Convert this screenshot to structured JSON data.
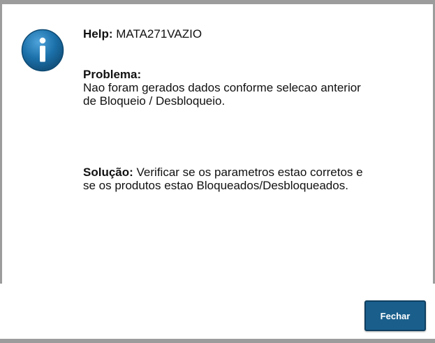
{
  "help": {
    "label": "Help:",
    "code": "MATA271VAZIO"
  },
  "problem": {
    "heading": "Problema:",
    "text_line1": "Nao foram gerados dados conforme selecao anterior",
    "text_line2": "de Bloqueio / Desbloqueio."
  },
  "solution": {
    "label": "Solução:",
    "text_line1": " Verificar se os parametros estao corretos e",
    "text_line2": "se os produtos estao Bloqueados/Desbloqueados."
  },
  "buttons": {
    "close_label": "Fechar"
  },
  "icon": {
    "name": "info-icon",
    "color": "#1b6fa8"
  },
  "colors": {
    "button_bg": "#1a5f8c",
    "frame": "#9c9c9c"
  }
}
